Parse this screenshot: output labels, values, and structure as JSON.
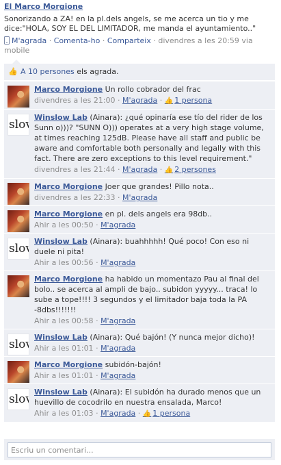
{
  "post": {
    "author": "El Marco Morgione",
    "text": "Sonorizando a ZA! en la pl.dels angels, se me acerca un tio y me dice:\"HOLA, SOY EL DEL LIMITADOR, me manda el ayuntamiento..\"",
    "actions": {
      "like": "M'agrada",
      "comment": "Comenta-ho",
      "share": "Comparteix"
    },
    "sep": "·",
    "timestamp": "divendres a les 20:59 via mobile"
  },
  "likes": {
    "people_link": "A 10 persones",
    "suffix": " els agrada."
  },
  "comments": [
    {
      "author": "Marco Morgione",
      "avatar": "photo",
      "text": "Un rollo cobrador del frac",
      "time": "divendres a les 21:00",
      "like": "M'agrada",
      "likes_count": "1 persona"
    },
    {
      "author": "Winslow Lab",
      "avatar": "logo",
      "text": "(Ainara): ¿qué opinaría ese tío del rider de los Sunn o)))? \"SUNN O))) operates at a very high stage volume, at times reaching 125dB. Please have all staff and public be aware and comfortable both personally and legally with this fact. There are zero exceptions to this level requirement.\"",
      "time": "divendres a les 21:44",
      "like": "M'agrada",
      "likes_count": "2 persones"
    },
    {
      "author": "Marco Morgione",
      "avatar": "photo",
      "text": "Joer que grandes! Pillo nota..",
      "time": "divendres a les 22:33",
      "like": "M'agrada",
      "likes_count": ""
    },
    {
      "author": "Marco Morgione",
      "avatar": "photo",
      "text": "en pl. dels angels era 98db..",
      "time": "Ahir a les 00:50",
      "like": "M'agrada",
      "likes_count": ""
    },
    {
      "author": "Winslow Lab",
      "avatar": "logo",
      "text": "(Ainara): buahhhhh! Qué poco! Con eso ni duele ni pita!",
      "time": "Ahir a les 00:56",
      "like": "M'agrada",
      "likes_count": ""
    },
    {
      "author": "Marco Morgione",
      "avatar": "photo",
      "text": "ha habido un momentazo Pau al final del bolo.. se acerca al ampli de bajo.. subidon yyyyy... traca! lo sube a tope!!!! 3 segundos y el limitador baja toda la PA -8dbs!!!!!!!",
      "time": "Ahir a les 00:58",
      "like": "M'agrada",
      "likes_count": ""
    },
    {
      "author": "Winslow Lab",
      "avatar": "logo",
      "text": "(Ainara): Qué bajón! (Y nunca mejor dicho)!",
      "time": "Ahir a les 01:01",
      "like": "M'agrada",
      "likes_count": ""
    },
    {
      "author": "Marco Morgione",
      "avatar": "photo",
      "text": "subidón-bajón!",
      "time": "Ahir a les 01:01",
      "like": "M'agrada",
      "likes_count": ""
    },
    {
      "author": "Winslow Lab",
      "avatar": "logo",
      "text": "(Ainara): El subidón ha durado menos que un huevillo de cocodrilo en nuestra ensalada, Marco!",
      "time": "Ahir a les 01:03",
      "like": "M'agrada",
      "likes_count": "1 persona"
    }
  ],
  "logo_text": "slov",
  "comment_input": {
    "placeholder": "Escriu un comentari..."
  },
  "colors": {
    "link": "#3b5998",
    "panel": "#edeff4",
    "meta": "#8c8c8c"
  }
}
